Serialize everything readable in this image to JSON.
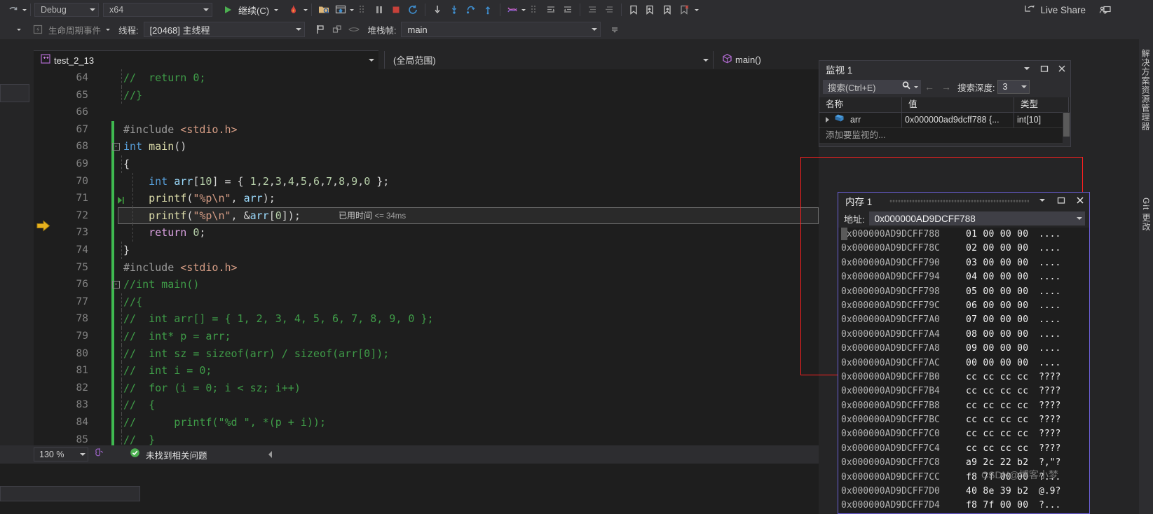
{
  "toolbar": {
    "undo_icon": "undo-arrow-icon",
    "config_value": "Debug",
    "platform_value": "x64",
    "continue_label": "继续(C)",
    "run_icon": "play-icon",
    "hot_reload_icon": "hot-reload-flame-icon",
    "open_folder_icon": "browse-folder-icon",
    "home_icon": "home-window-icon",
    "break_all_icon": "pause-icon",
    "stop_icon": "stop-square-icon",
    "restart_icon": "restart-icon",
    "step_into_icon": "step-into-icon",
    "step_over_icon": "step-over-icon",
    "step_out_icon": "step-out-icon",
    "show_next_icon": "show-next-statement-icon",
    "threads_icon": "threads-icon",
    "indent_icon": "indent-icon",
    "outdent_icon": "outdent-icon",
    "comment_icon": "comment-icon",
    "uncomment_icon": "uncomment-icon",
    "bookmark_icon": "bookmark-icon",
    "prev_bookmark_icon": "previous-bookmark-icon",
    "next_bookmark_icon": "next-bookmark-icon",
    "clear_bookmarks_icon": "clear-bookmarks-icon",
    "live_share_label": "Live Share",
    "live_share_icon": "live-share-icon",
    "account_icon": "account-feedback-icon"
  },
  "debug_toolbar": {
    "lifecycle_events_label": "生命周期事件",
    "lifecycle_icon": "lifecycle-events-icon",
    "thread_label": "线程:",
    "thread_value": "[20468] 主线程",
    "frame_label": "堆栈帧:",
    "frame_value": "main",
    "flag_icon": "flag-icon",
    "parallel_stacks_icon": "parallel-stacks-icon",
    "watch_small_icon": "watch-tasks-icon",
    "overflow_icon": "toolbar-overflow-icon"
  },
  "tab": {
    "file_name": "test_2_13",
    "file_icon": "cpp-file-icon",
    "dropdown_icon": "chevron-down-icon"
  },
  "navbar": {
    "scope_value": "(全局范围)",
    "member_value": "main()",
    "member_icon": "method-cube-icon"
  },
  "editor": {
    "current_line": 72,
    "execution_arrow_icon": "current-statement-arrow-icon",
    "breakpoint_icon": "breakpoint-glyph-icon",
    "time_tip_label": "已用时间",
    "time_tip_value": "<= 34ms",
    "lines": [
      {
        "n": "64",
        "indent": 0,
        "text": "//  return 0;",
        "kind": "comment",
        "changed": false,
        "guide": true
      },
      {
        "n": "65",
        "indent": 0,
        "text": "//}",
        "kind": "comment",
        "changed": false,
        "guide": true
      },
      {
        "n": "66",
        "indent": 0,
        "text": "",
        "kind": "blank",
        "changed": false,
        "guide": false
      },
      {
        "n": "67",
        "indent": 0,
        "text": "#include <stdio.h>",
        "kind": "include",
        "changed": true,
        "guide": false
      },
      {
        "n": "68",
        "indent": 0,
        "text": "int main()",
        "kind": "code",
        "changed": true,
        "guide": false,
        "fold": "-"
      },
      {
        "n": "69",
        "indent": 0,
        "text": "{",
        "kind": "code",
        "changed": true,
        "guide": true
      },
      {
        "n": "70",
        "indent": 1,
        "text": "int arr[10] = { 1,2,3,4,5,6,7,8,9,0 };",
        "kind": "code",
        "changed": true,
        "guide": true
      },
      {
        "n": "71",
        "indent": 1,
        "text": "printf(\"%p\\n\", arr);",
        "kind": "code",
        "changed": true,
        "guide": true
      },
      {
        "n": "72",
        "indent": 1,
        "text": "printf(\"%p\\n\", &arr[0]);",
        "kind": "code",
        "changed": true,
        "guide": true
      },
      {
        "n": "73",
        "indent": 1,
        "text": "return 0;",
        "kind": "code",
        "changed": true,
        "guide": true
      },
      {
        "n": "74",
        "indent": 0,
        "text": "}",
        "kind": "code",
        "changed": true,
        "guide": true
      },
      {
        "n": "75",
        "indent": 0,
        "text": "#include <stdio.h>",
        "kind": "include",
        "changed": true,
        "guide": false
      },
      {
        "n": "76",
        "indent": 0,
        "text": "//int main()",
        "kind": "comment",
        "changed": true,
        "guide": false,
        "fold": "-"
      },
      {
        "n": "77",
        "indent": 0,
        "text": "//{",
        "kind": "comment",
        "changed": true,
        "guide": true
      },
      {
        "n": "78",
        "indent": 0,
        "text": "//  int arr[] = { 1, 2, 3, 4, 5, 6, 7, 8, 9, 0 };",
        "kind": "comment",
        "changed": true,
        "guide": true
      },
      {
        "n": "79",
        "indent": 0,
        "text": "//  int* p = arr;",
        "kind": "comment",
        "changed": true,
        "guide": true
      },
      {
        "n": "80",
        "indent": 0,
        "text": "//  int sz = sizeof(arr) / sizeof(arr[0]);",
        "kind": "comment",
        "changed": true,
        "guide": true
      },
      {
        "n": "81",
        "indent": 0,
        "text": "//  int i = 0;",
        "kind": "comment",
        "changed": true,
        "guide": true
      },
      {
        "n": "82",
        "indent": 0,
        "text": "//  for (i = 0; i < sz; i++)",
        "kind": "comment",
        "changed": true,
        "guide": true
      },
      {
        "n": "83",
        "indent": 0,
        "text": "//  {",
        "kind": "comment",
        "changed": true,
        "guide": true
      },
      {
        "n": "84",
        "indent": 0,
        "text": "//      printf(\"%d \", *(p + i));",
        "kind": "comment",
        "changed": true,
        "guide": true
      },
      {
        "n": "85",
        "indent": 0,
        "text": "//  }",
        "kind": "comment",
        "changed": true,
        "guide": true
      }
    ]
  },
  "statusbar": {
    "zoom_value": "130 %",
    "zoom_caret_icon": "chevron-down-icon",
    "feedback_icon": "intellicode-brain-icon",
    "status_icon": "check-circle-icon",
    "status_text": "未找到相关问题",
    "collapse_icon": "collapse-left-icon"
  },
  "watch_window": {
    "title": "监视 1",
    "pin_icon": "window-menu-icon",
    "maximize_icon": "maximize-icon",
    "close_icon": "close-icon",
    "search_placeholder": "搜索(Ctrl+E)",
    "search_icon": "search-magnifier-icon",
    "search_caret_icon": "chevron-down-icon",
    "prev_icon": "arrow-left-icon",
    "next_icon": "arrow-right-icon",
    "depth_label": "搜索深度:",
    "depth_value": "3",
    "columns": [
      "名称",
      "值",
      "类型"
    ],
    "rows": [
      {
        "expander_icon": "expand-triangle-icon",
        "value_icon": "array-object-icon",
        "name": "arr",
        "value": "0x000000ad9dcff788 {...",
        "type": "int[10]"
      }
    ],
    "add_row_placeholder": "添加要监视的..."
  },
  "memory_window": {
    "title": "内存 1",
    "grip_icon": "window-drag-grip",
    "menu_icon": "window-menu-icon",
    "maximize_icon": "maximize-icon",
    "close_icon": "close-icon",
    "address_label": "地址:",
    "address_value": "0x000000AD9DCFF788",
    "address_caret_icon": "chevron-down-icon",
    "rows": [
      {
        "addr": "0x000000AD9DCFF788",
        "hex": "01 00 00 00",
        "ascii": "...."
      },
      {
        "addr": "0x000000AD9DCFF78C",
        "hex": "02 00 00 00",
        "ascii": "...."
      },
      {
        "addr": "0x000000AD9DCFF790",
        "hex": "03 00 00 00",
        "ascii": "...."
      },
      {
        "addr": "0x000000AD9DCFF794",
        "hex": "04 00 00 00",
        "ascii": "...."
      },
      {
        "addr": "0x000000AD9DCFF798",
        "hex": "05 00 00 00",
        "ascii": "...."
      },
      {
        "addr": "0x000000AD9DCFF79C",
        "hex": "06 00 00 00",
        "ascii": "...."
      },
      {
        "addr": "0x000000AD9DCFF7A0",
        "hex": "07 00 00 00",
        "ascii": "...."
      },
      {
        "addr": "0x000000AD9DCFF7A4",
        "hex": "08 00 00 00",
        "ascii": "...."
      },
      {
        "addr": "0x000000AD9DCFF7A8",
        "hex": "09 00 00 00",
        "ascii": "...."
      },
      {
        "addr": "0x000000AD9DCFF7AC",
        "hex": "00 00 00 00",
        "ascii": "...."
      },
      {
        "addr": "0x000000AD9DCFF7B0",
        "hex": "cc cc cc cc",
        "ascii": "????"
      },
      {
        "addr": "0x000000AD9DCFF7B4",
        "hex": "cc cc cc cc",
        "ascii": "????"
      },
      {
        "addr": "0x000000AD9DCFF7B8",
        "hex": "cc cc cc cc",
        "ascii": "????"
      },
      {
        "addr": "0x000000AD9DCFF7BC",
        "hex": "cc cc cc cc",
        "ascii": "????"
      },
      {
        "addr": "0x000000AD9DCFF7C0",
        "hex": "cc cc cc cc",
        "ascii": "????"
      },
      {
        "addr": "0x000000AD9DCFF7C4",
        "hex": "cc cc cc cc",
        "ascii": "????"
      },
      {
        "addr": "0x000000AD9DCFF7C8",
        "hex": "a9 2c 22 b2",
        "ascii": "?,\"?"
      },
      {
        "addr": "0x000000AD9DCFF7CC",
        "hex": "f8 7f 00 00",
        "ascii": "?..."
      },
      {
        "addr": "0x000000AD9DCFF7D0",
        "hex": "40 8e 39 b2",
        "ascii": "@.9?"
      },
      {
        "addr": "0x000000AD9DCFF7D4",
        "hex": "f8 7f 00 00",
        "ascii": "?..."
      }
    ]
  },
  "right_dock": {
    "solution_explorer_label": "解决方案资源管理器",
    "git_changes_label": "Git 更改"
  },
  "watermark": {
    "text": "CSDN@博客小梦"
  },
  "colors": {
    "accent": "#007acc",
    "comment_green": "#3f9c48",
    "keyword_blue": "#569cd6",
    "string_orange": "#d69d85",
    "changed_bar_green": "#3fb950",
    "memory_border": "#6b5fd6",
    "annotation_red": "#ff2020"
  }
}
